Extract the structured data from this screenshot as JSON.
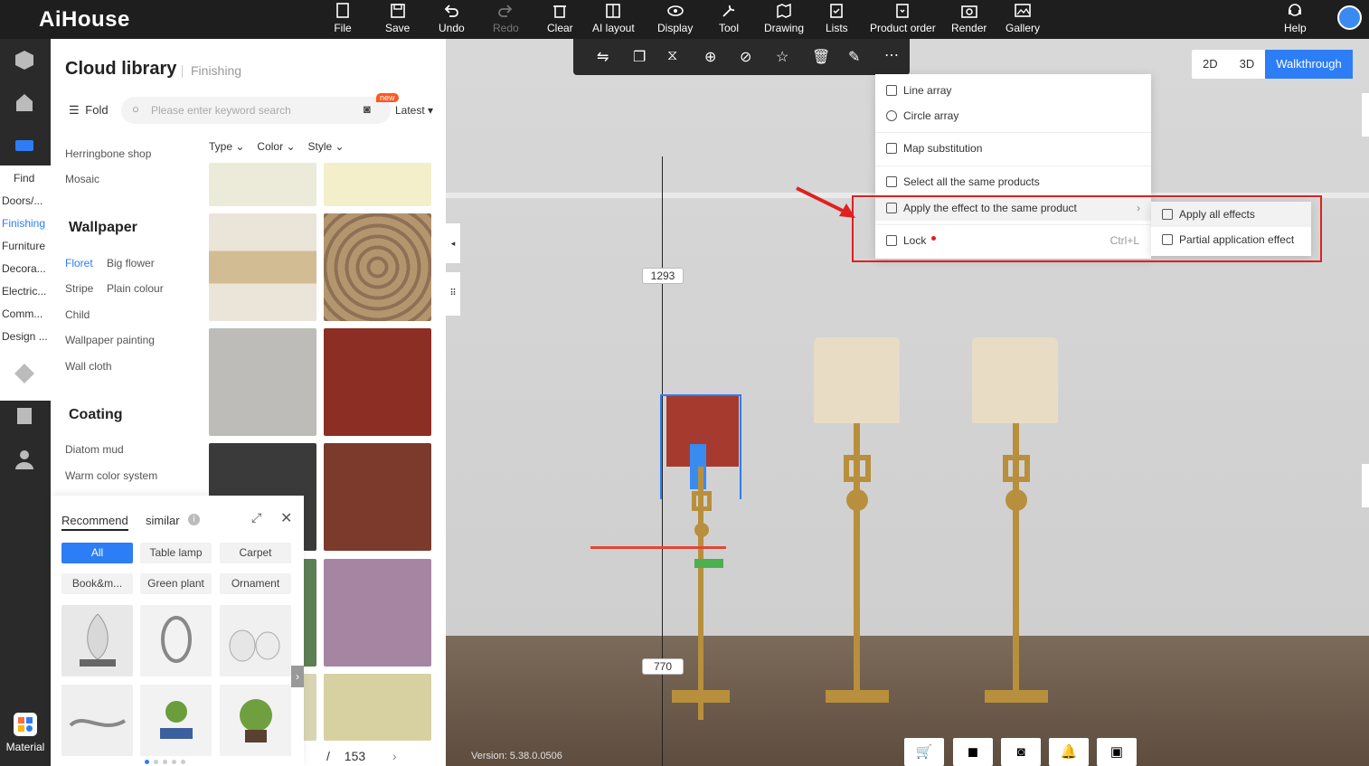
{
  "app": {
    "logo": "AiHouse"
  },
  "toolbar": [
    {
      "label": "File",
      "icon": "file-icon"
    },
    {
      "label": "Save",
      "icon": "save-icon"
    },
    {
      "label": "Undo",
      "icon": "undo-icon"
    },
    {
      "label": "Redo",
      "icon": "redo-icon"
    },
    {
      "label": "Clear",
      "icon": "clear-icon"
    },
    {
      "label": "AI layout",
      "icon": "ai-layout-icon"
    },
    {
      "label": "Display",
      "icon": "display-icon"
    },
    {
      "label": "Tool",
      "icon": "tool-icon"
    },
    {
      "label": "Drawing",
      "icon": "drawing-icon"
    },
    {
      "label": "Lists",
      "icon": "lists-icon"
    },
    {
      "label": "Product order",
      "icon": "product-order-icon"
    },
    {
      "label": "Render",
      "icon": "render-icon"
    },
    {
      "label": "Gallery",
      "icon": "gallery-icon"
    },
    {
      "label": "Help",
      "icon": "help-icon"
    }
  ],
  "leftnav": {
    "categories": [
      "Find",
      "Doors/...",
      "Finishing",
      "Furniture",
      "Decora...",
      "Electric...",
      "Comm...",
      "Design ..."
    ],
    "material_label": "Material"
  },
  "panel": {
    "title": "Cloud library",
    "subtitle": "Finishing",
    "fold_label": "Fold",
    "search_placeholder": "Please enter keyword search",
    "new_badge": "new",
    "sort_label": "Latest",
    "filters": [
      "Type",
      "Color",
      "Style"
    ],
    "subcats_top": [
      "Herringbone shop",
      "Mosaic"
    ],
    "wallpaper": {
      "heading": "Wallpaper",
      "items": [
        "Floret",
        "Big flower",
        "Stripe",
        "Plain colour",
        "Child",
        "Wallpaper painting",
        "Wall cloth"
      ]
    },
    "coating": {
      "heading": "Coating",
      "items": [
        "Diatom mud",
        "Warm color system"
      ]
    },
    "pager": {
      "separator": "/",
      "total": "153"
    }
  },
  "recommend": {
    "tabs": [
      "Recommend",
      "similar"
    ],
    "chips": [
      "All",
      "Table lamp",
      "Carpet",
      "Book&m...",
      "Green plant",
      "Ornament"
    ]
  },
  "viewport": {
    "view_buttons": [
      "2D",
      "3D",
      "Walkthrough"
    ],
    "dimensions": [
      "1293",
      "770"
    ],
    "version": "Version: 5.38.0.0506"
  },
  "context_menu": {
    "items": [
      {
        "label": "Line array",
        "icon": "line-array-icon"
      },
      {
        "label": "Circle array",
        "icon": "circle-array-icon"
      },
      {
        "label": "Map substitution",
        "icon": "map-substitution-icon"
      },
      {
        "label": "Select all the same products",
        "icon": "select-same-icon"
      },
      {
        "label": "Apply the effect to the same product",
        "icon": "apply-effect-icon"
      },
      {
        "label": "Lock",
        "icon": "lock-icon",
        "shortcut": "Ctrl+L"
      }
    ],
    "submenu": [
      {
        "label": "Apply all effects",
        "icon": "apply-all-icon"
      },
      {
        "label": "Partial application effect",
        "icon": "partial-apply-icon"
      }
    ]
  },
  "colors": {
    "accent": "#2d7df6",
    "topbar": "#1e1e1e",
    "highlight_box": "#e02020"
  }
}
